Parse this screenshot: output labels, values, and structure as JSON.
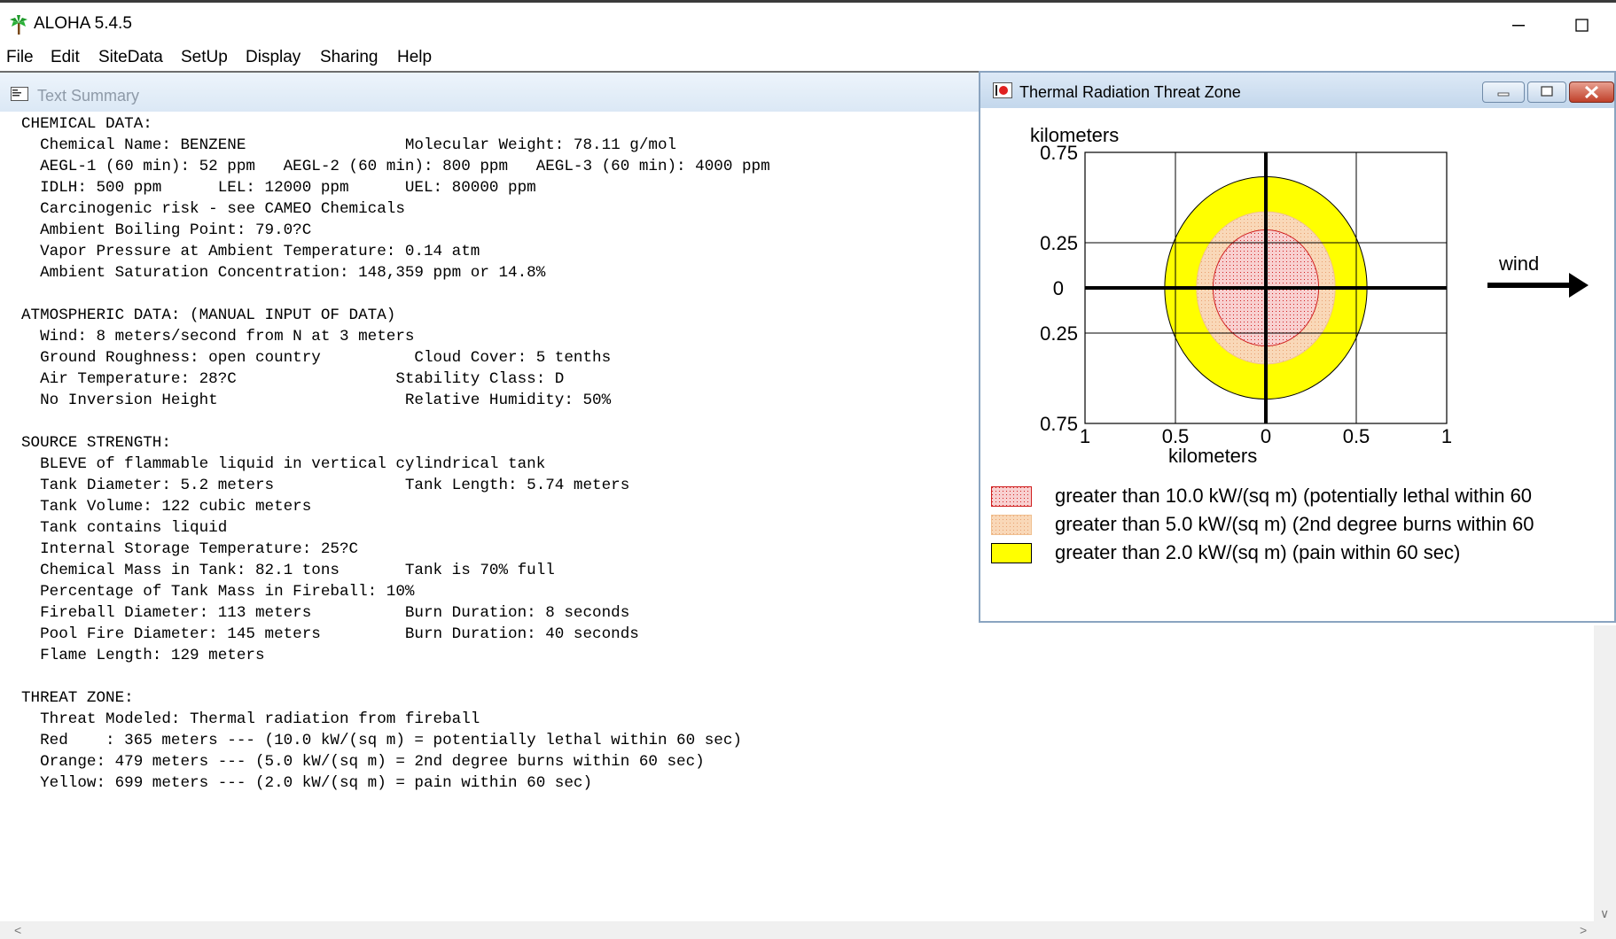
{
  "app": {
    "title": "ALOHA 5.4.5",
    "icon": "palm-tree-icon"
  },
  "menu": [
    "File",
    "Edit",
    "SiteData",
    "SetUp",
    "Display",
    "Sharing",
    "Help"
  ],
  "text_summary": {
    "title": "Text Summary",
    "lines": [
      "CHEMICAL DATA:",
      "  Chemical Name: BENZENE                 Molecular Weight: 78.11 g/mol",
      "  AEGL-1 (60 min): 52 ppm   AEGL-2 (60 min): 800 ppm   AEGL-3 (60 min): 4000 ppm",
      "  IDLH: 500 ppm      LEL: 12000 ppm      UEL: 80000 ppm",
      "  Carcinogenic risk - see CAMEO Chemicals",
      "  Ambient Boiling Point: 79.0?C",
      "  Vapor Pressure at Ambient Temperature: 0.14 atm",
      "  Ambient Saturation Concentration: 148,359 ppm or 14.8%",
      "",
      "ATMOSPHERIC DATA: (MANUAL INPUT OF DATA)",
      "  Wind: 8 meters/second from N at 3 meters",
      "  Ground Roughness: open country          Cloud Cover: 5 tenths",
      "  Air Temperature: 28?C                 Stability Class: D",
      "  No Inversion Height                    Relative Humidity: 50%",
      "",
      "SOURCE STRENGTH:",
      "  BLEVE of flammable liquid in vertical cylindrical tank",
      "  Tank Diameter: 5.2 meters              Tank Length: 5.74 meters",
      "  Tank Volume: 122 cubic meters",
      "  Tank contains liquid",
      "  Internal Storage Temperature: 25?C",
      "  Chemical Mass in Tank: 82.1 tons       Tank is 70% full",
      "  Percentage of Tank Mass in Fireball: 10%",
      "  Fireball Diameter: 113 meters          Burn Duration: 8 seconds",
      "  Pool Fire Diameter: 145 meters         Burn Duration: 40 seconds",
      "  Flame Length: 129 meters",
      "",
      "THREAT ZONE:",
      "  Threat Modeled: Thermal radiation from fireball",
      "  Red    : 365 meters --- (10.0 kW/(sq m) = potentially lethal within 60 sec)",
      "  Orange: 479 meters --- (5.0 kW/(sq m) = 2nd degree burns within 60 sec)",
      "  Yellow: 699 meters --- (2.0 kW/(sq m) = pain within 60 sec)"
    ]
  },
  "threat_window": {
    "title": "Thermal Radiation Threat Zone",
    "y_unit": "kilometers",
    "x_unit": "kilometers",
    "y_ticks": [
      "0.75",
      "0.25",
      "0",
      "0.25",
      "0.75"
    ],
    "x_ticks": [
      "1",
      "0.5",
      "0",
      "0.5",
      "1"
    ],
    "wind_label": "wind",
    "legend": [
      {
        "label": "greater than 10.0 kW/(sq m) (potentially lethal within 60",
        "color": "#e03030",
        "pattern": "red-dots"
      },
      {
        "label": "greater than 5.0 kW/(sq m) (2nd degree burns within 60",
        "color": "#f7c8a0",
        "pattern": "orange-dots"
      },
      {
        "label": "greater than 2.0 kW/(sq m) (pain within 60 sec)",
        "color": "#ffff00",
        "pattern": "solid"
      }
    ],
    "zones_km": [
      {
        "name": "Yellow",
        "radius": 0.699,
        "color": "#ffff00"
      },
      {
        "name": "Orange",
        "radius": 0.479,
        "color": "#f7c8a0"
      },
      {
        "name": "Red",
        "radius": 0.365,
        "color": "#f8d0d0"
      }
    ]
  }
}
